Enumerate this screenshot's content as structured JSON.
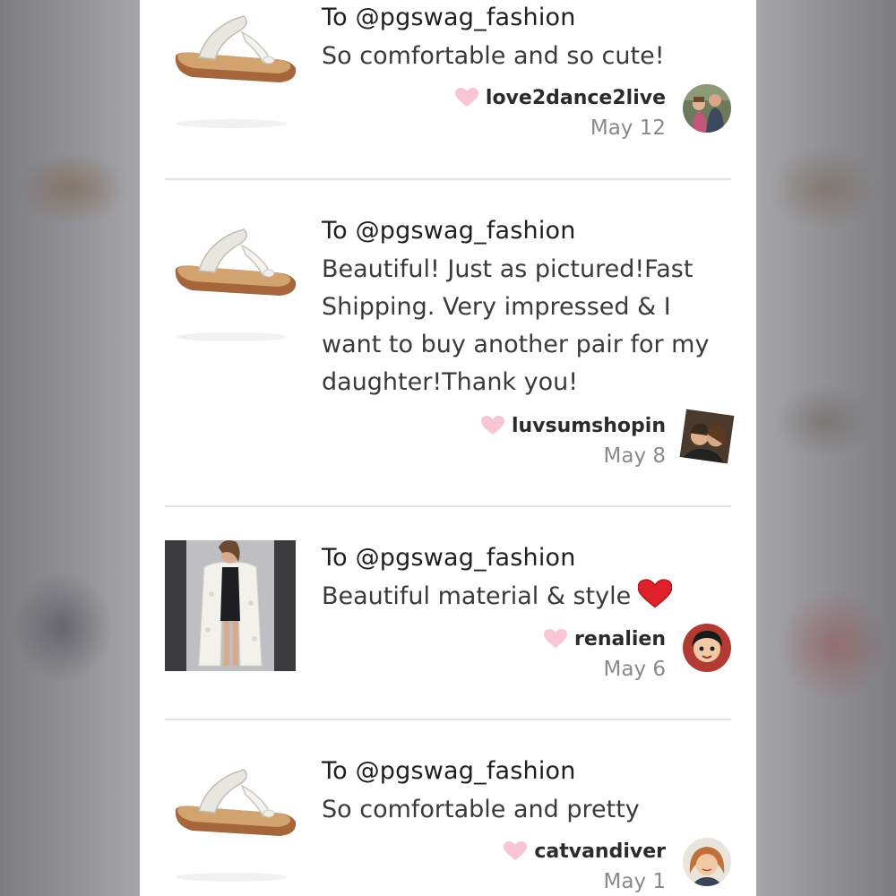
{
  "reviews": [
    {
      "to": "To @pgswag_fashion",
      "text": "So comfortable and so cute!",
      "username": "love2dance2live",
      "date": "May 12",
      "thumbnail": "sandal",
      "avatar": "couple-outdoors"
    },
    {
      "to": "To @pgswag_fashion",
      "text": "Beautiful! Just as pictured!Fast Shipping. Very impressed & I want to buy another pair for my daughter!Thank you!",
      "username": "luvsumshopin",
      "date": "May 8",
      "thumbnail": "sandal",
      "avatar": "couple-selfie"
    },
    {
      "to": "To @pgswag_fashion",
      "text": "Beautiful material & style",
      "username": "renalien",
      "date": "May 6",
      "thumbnail": "lace-kimono",
      "avatar": "cartoon-character",
      "emoji": "red-heart"
    },
    {
      "to": "To @pgswag_fashion",
      "text": "So comfortable and pretty",
      "username": "catvandiver",
      "date": "May 1",
      "thumbnail": "sandal",
      "avatar": "woman-portrait"
    }
  ],
  "colors": {
    "like_heart": "#f7c6d2",
    "emoji_heart": "#e0202b",
    "text": "#3a3a3a",
    "date": "#8a8a8a",
    "divider": "#e4e4e4"
  }
}
